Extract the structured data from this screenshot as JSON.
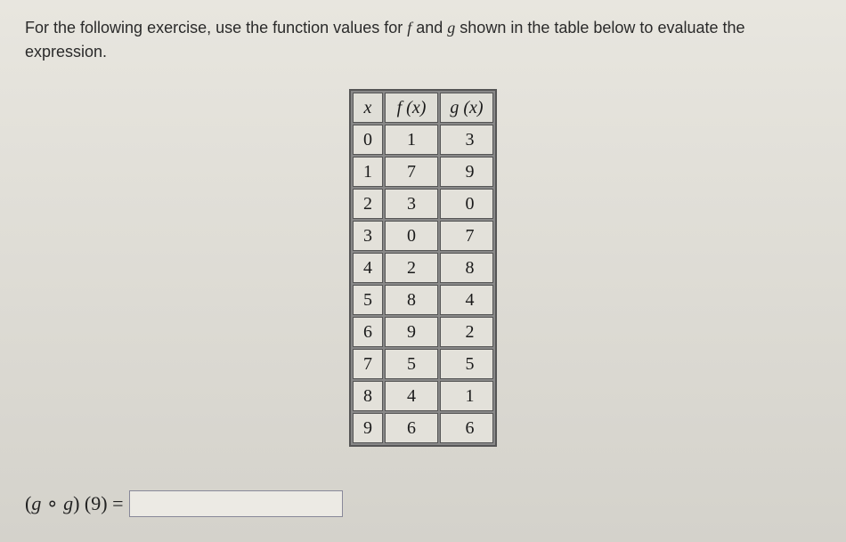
{
  "instruction_pre": "For the following exercise, use the function values for ",
  "instruction_f": "f",
  "instruction_mid": " and ",
  "instruction_g": "g",
  "instruction_post": " shown in the table below to evaluate the expression.",
  "table": {
    "headers": {
      "x": "x",
      "fx": "f (x)",
      "gx": "g (x)"
    },
    "rows": [
      {
        "x": "0",
        "fx": "1",
        "gx": "3"
      },
      {
        "x": "1",
        "fx": "7",
        "gx": "9"
      },
      {
        "x": "2",
        "fx": "3",
        "gx": "0"
      },
      {
        "x": "3",
        "fx": "0",
        "gx": "7"
      },
      {
        "x": "4",
        "fx": "2",
        "gx": "8"
      },
      {
        "x": "5",
        "fx": "8",
        "gx": "4"
      },
      {
        "x": "6",
        "fx": "9",
        "gx": "2"
      },
      {
        "x": "7",
        "fx": "5",
        "gx": "5"
      },
      {
        "x": "8",
        "fx": "4",
        "gx": "1"
      },
      {
        "x": "9",
        "fx": "6",
        "gx": "6"
      }
    ]
  },
  "expression": {
    "open": "(",
    "g1": "g",
    "circ": " ∘ ",
    "g2": "g",
    "close_arg": ") (9)",
    "equals": " ="
  },
  "answer_value": ""
}
